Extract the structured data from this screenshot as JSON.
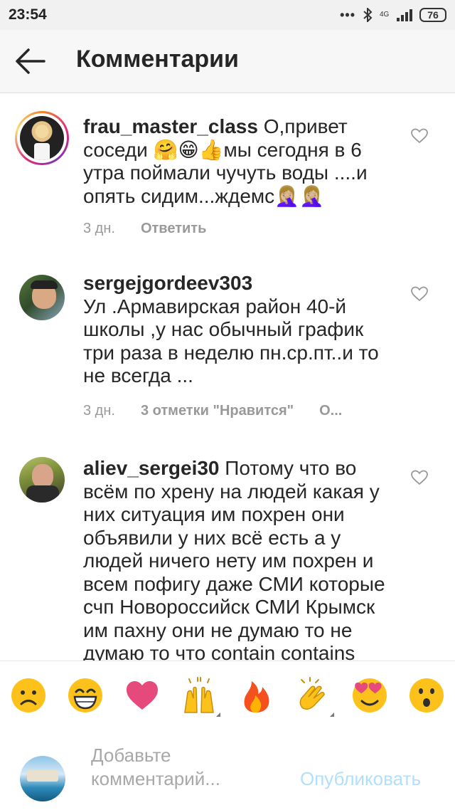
{
  "status_bar": {
    "time": "23:54",
    "dots": "•••",
    "network": "4G",
    "battery": "76",
    "icons": [
      "bluetooth-icon",
      "signal-icon",
      "battery-icon"
    ]
  },
  "header": {
    "title": "Комментарии",
    "back_icon": "arrow-left-icon"
  },
  "comments": [
    {
      "username": "frau_master_class",
      "text": " О,привет соседи 🤗😁👍мы сегодня в 6 утра поймали чучуть воды ....и опять сидим...ждемс🤦🏼‍♀️🤦🏼‍♀️",
      "time": "3 дн.",
      "actions": [
        "Ответить"
      ],
      "has_story": true
    },
    {
      "username": "sergejgordeev303",
      "text": "Ул .Армавирская район 40-й школы ,у нас обычный график три раза в неделю пн.ср.пт..и то не всегда ...",
      "time": "3 дн.",
      "actions": [
        "3 отметки \"Нравится\"",
        "О..."
      ],
      "has_story": false
    },
    {
      "username": "aliev_sergei30",
      "text": " Потому что во всём по хрену на людей какая у них ситуация им похрен они объявили у них всё есть а у людей ничего нету им похрен и всем пофигу даже СМИ которые счп Новороссийск СМИ Крымск им пахну они не думаю то не думаю то что contain contains",
      "time": "",
      "actions": [],
      "has_story": false
    }
  ],
  "emoji_bar": [
    "☹️",
    "😁",
    "❤️",
    "🙌",
    "🔥",
    "👏",
    "😍",
    "😮"
  ],
  "input": {
    "placeholder": "Добавьте комментарий...",
    "publish_label": "Опубликовать"
  },
  "colors": {
    "accent": "#3897f0",
    "publish_disabled": "#b2dffc",
    "meta": "#999999"
  }
}
